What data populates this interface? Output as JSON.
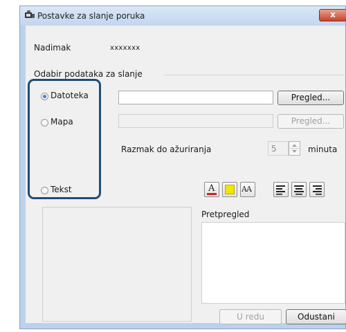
{
  "window": {
    "title": "Postavke za slanje poruka",
    "close_label": "x"
  },
  "nickname": {
    "label": "Nadimak",
    "value": "xxxxxxx"
  },
  "data_group": {
    "title": "Odabir podataka za slanje",
    "options": [
      {
        "label": "Datoteka",
        "checked": true
      },
      {
        "label": "Mapa",
        "checked": false
      },
      {
        "label": "Tekst",
        "checked": false
      }
    ],
    "browse_file_label": "Pregled...",
    "browse_folder_label": "Pregled..."
  },
  "update_interval": {
    "label": "Razmak do ažuriranja",
    "value": "5",
    "unit": "minuta"
  },
  "format_toolbar": {
    "font_color_glyph": "A",
    "font_size_glyph": "AA",
    "accent_red": "#d42020",
    "highlight_yellow": "#f2e600"
  },
  "preview": {
    "label": "Pretpregled"
  },
  "footer": {
    "ok_label": "U redu",
    "cancel_label": "Odustani"
  },
  "colors": {
    "selection_outline": "#1f4b78",
    "radio_checked": "#3d7fd6"
  }
}
